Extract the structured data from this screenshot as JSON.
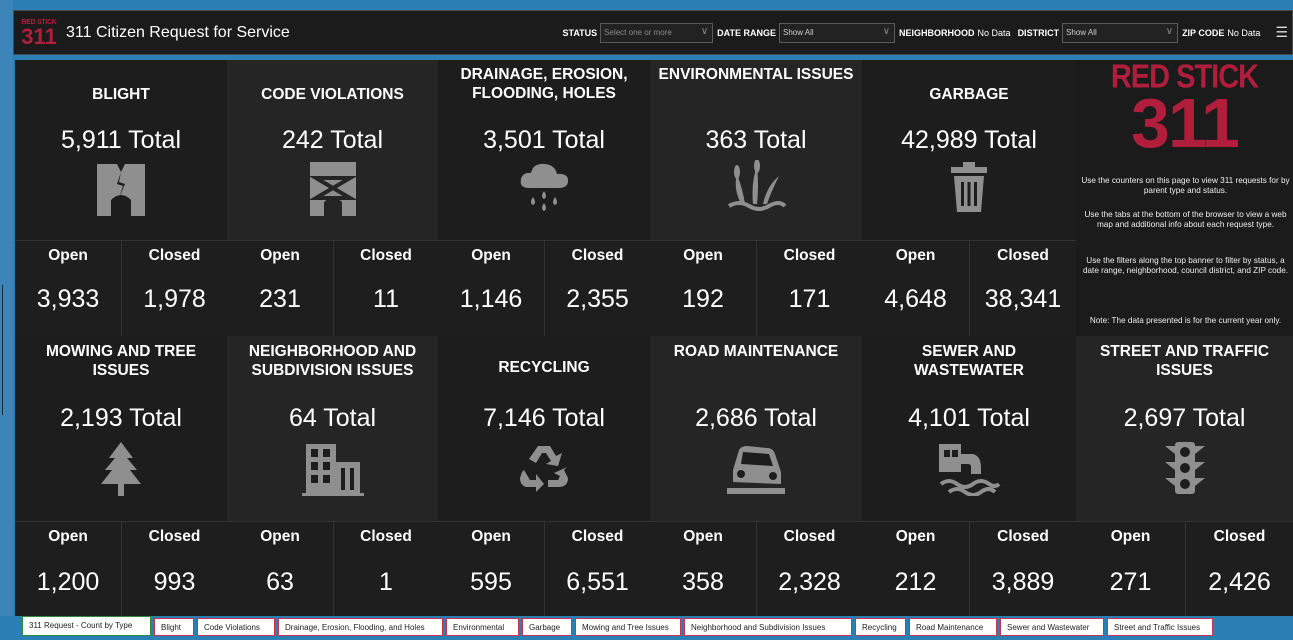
{
  "header": {
    "logo_top": "RED STICK",
    "logo_bottom": "311",
    "title": "311 Citizen Request for Service",
    "filters": {
      "status_label": "STATUS",
      "status_placeholder": "Select one or more",
      "date_label": "DATE RANGE",
      "date_value": "Show All",
      "neighborhood_label": "NEIGHBORHOOD",
      "neighborhood_value": "No Data",
      "district_label": "DISTRICT",
      "district_value": "Show All",
      "zip_label": "ZIP CODE",
      "zip_value": "No Data"
    }
  },
  "labels": {
    "open": "Open",
    "closed": "Closed"
  },
  "categories": [
    {
      "title": "BLIGHT",
      "total": "5,911 Total",
      "open": "3,933",
      "closed": "1,978",
      "icon": "blight-icon"
    },
    {
      "title": "CODE VIOLATIONS",
      "total": "242 Total",
      "open": "231",
      "closed": "11",
      "icon": "code-violation-icon"
    },
    {
      "title": "DRAINAGE, EROSION, FLOODING, HOLES",
      "total": "3,501 Total",
      "open": "1,146",
      "closed": "2,355",
      "icon": "rain-cloud-icon"
    },
    {
      "title": "ENVIRONMENTAL ISSUES",
      "total": "363 Total",
      "open": "192",
      "closed": "171",
      "icon": "grass-icon"
    },
    {
      "title": "GARBAGE",
      "total": "42,989 Total",
      "open": "4,648",
      "closed": "38,341",
      "icon": "trash-can-icon"
    },
    {
      "title": "MOWING AND TREE ISSUES",
      "total": "2,193 Total",
      "open": "1,200",
      "closed": "993",
      "icon": "tree-icon"
    },
    {
      "title": "NEIGHBORHOOD AND SUBDIVISION ISSUES",
      "total": "64 Total",
      "open": "63",
      "closed": "1",
      "icon": "buildings-icon"
    },
    {
      "title": "RECYCLING",
      "total": "7,146 Total",
      "open": "595",
      "closed": "6,551",
      "icon": "recycle-icon"
    },
    {
      "title": "ROAD MAINTENANCE",
      "total": "2,686 Total",
      "open": "358",
      "closed": "2,328",
      "icon": "car-pothole-icon"
    },
    {
      "title": "SEWER AND WASTEWATER",
      "total": "4,101 Total",
      "open": "212",
      "closed": "3,889",
      "icon": "sewer-icon"
    },
    {
      "title": "STREET AND TRAFFIC ISSUES",
      "total": "2,697 Total",
      "open": "271",
      "closed": "2,426",
      "icon": "traffic-light-icon"
    }
  ],
  "info": {
    "logo_top": "RED STICK",
    "logo_bottom": "311",
    "p1": "Use the counters on this page to view 311 requests for by parent type and status.",
    "p2": "Use the tabs at the bottom of the browser to view a web map and additional info about each request type.",
    "p3": "Use the filters along the top banner to filter by status, a date range, neighborhood, council district, and ZIP code.",
    "p4": "Note:  The data presented is for the current year only."
  },
  "tabs": [
    "311 Request - Count by Type",
    "Blight",
    "Code Violations",
    "Drainage, Erosion, Flooding, and Holes",
    "Environmental",
    "Garbage",
    "Mowing and Tree Issues",
    "Neighborhood and Subdivision Issues",
    "Recycling",
    "Road Maintenance",
    "Sewer and Wastewater",
    "Street and Traffic Issues"
  ],
  "colors": {
    "brand_red": "#b01e3c",
    "background": "#1b1b1b",
    "frame_blue": "#2a7fb5",
    "icon_gray": "#8f8f8f"
  }
}
